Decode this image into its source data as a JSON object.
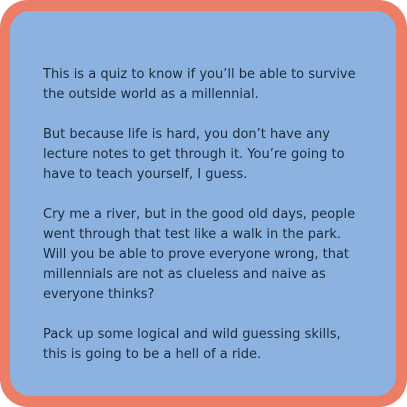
{
  "colors": {
    "border": "#ec7e67",
    "card": "#8cb3e0",
    "text": "#1d2a3a"
  },
  "card": {
    "paragraphs": [
      "This is a quiz to know if you’ll be able to survive the outside world as a millennial.",
      "But because life is hard, you don’t have any lecture notes to get through it. You’re going to have to teach yourself, I guess.",
      "Cry me a river, but in the good old days, people went through that test like a walk in the park. Will you be able to prove everyone wrong, that millennials are not as clueless and naive as everyone thinks?",
      "Pack up some logical and wild guessing skills, this is going to be a hell of a ride."
    ]
  }
}
